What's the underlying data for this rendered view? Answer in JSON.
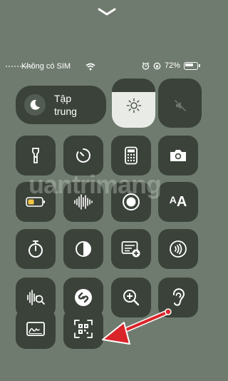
{
  "status": {
    "carrier": "Không có SIM",
    "battery_pct": "72%",
    "battery_level": 0.72
  },
  "focus": {
    "label_line1": "Tập",
    "label_line2": "trung"
  },
  "sliders": {
    "brightness_level": 0.72,
    "volume_muted": true
  },
  "watermark": "uantrimang",
  "controls": [
    {
      "name": "flashlight",
      "icon": "flashlight-icon"
    },
    {
      "name": "timer",
      "icon": "timer-icon"
    },
    {
      "name": "calculator",
      "icon": "calculator-icon"
    },
    {
      "name": "camera",
      "icon": "camera-icon"
    },
    {
      "name": "low-power-mode",
      "icon": "battery-icon"
    },
    {
      "name": "voice-memos",
      "icon": "waveform-icon"
    },
    {
      "name": "screen-recording",
      "icon": "record-icon"
    },
    {
      "name": "text-size",
      "icon": "text-size-icon",
      "text": "AA"
    },
    {
      "name": "stopwatch",
      "icon": "stopwatch-icon"
    },
    {
      "name": "dark-mode",
      "icon": "dark-mode-icon"
    },
    {
      "name": "quick-note",
      "icon": "quick-note-icon"
    },
    {
      "name": "nfc-reader",
      "icon": "nfc-icon"
    },
    {
      "name": "sound-recognition",
      "icon": "sound-recognition-icon"
    },
    {
      "name": "shazam",
      "icon": "shazam-icon"
    },
    {
      "name": "magnifier",
      "icon": "magnifier-icon"
    },
    {
      "name": "hearing",
      "icon": "ear-icon"
    },
    {
      "name": "notes",
      "icon": "sign-icon"
    },
    {
      "name": "code-scanner",
      "icon": "qr-scan-icon"
    }
  ],
  "colors": {
    "background": "#6f7b6e",
    "tile": "#3a4239",
    "slider_fill": "#e9ece6",
    "arrow": "#d9252a"
  }
}
